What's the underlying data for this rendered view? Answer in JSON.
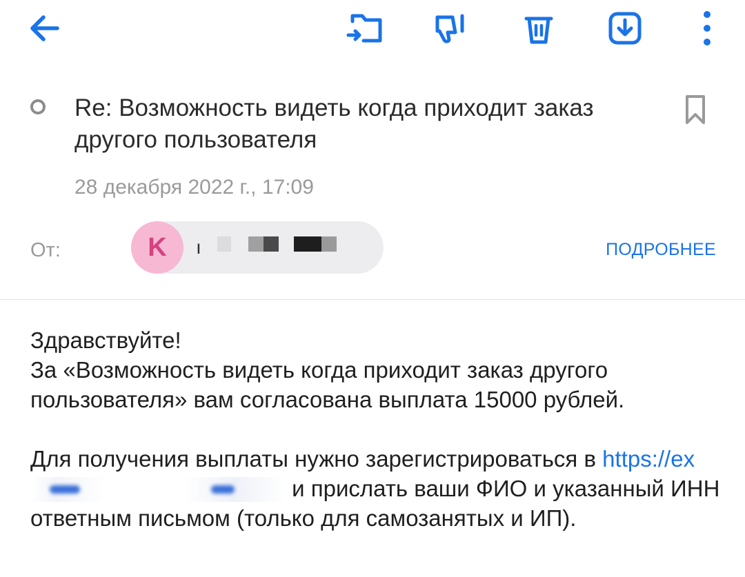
{
  "toolbar": {
    "back_icon": "arrow-left-icon",
    "move_icon": "folder-move-icon",
    "spam_icon": "thumbs-down-icon",
    "delete_icon": "trash-icon",
    "save_icon": "download-icon",
    "more_icon": "more-vertical-icon",
    "accent_color": "#1a73e8"
  },
  "message": {
    "subject": "Re: Возможность видеть когда приходит заказ другого пользователя",
    "date": "28 декабря 2022 г., 17:09",
    "from_label": "От:",
    "sender_initial": "K",
    "sender_name_visible": "ı",
    "details_label": "ПОДРОБНЕЕ"
  },
  "body": {
    "greeting": "Здравствуйте!",
    "paragraph1": "За «Возможность видеть когда приходит заказ другого пользователя» вам согласована выплата 15000 рублей.",
    "paragraph2_start": "Для получения выплаты нужно зарегистрироваться в",
    "link_text": "https://ex",
    "paragraph2_end": "и прислать ваши ФИО и указанный ИНН ответным письмом (только для самозанятых и ИП)."
  }
}
